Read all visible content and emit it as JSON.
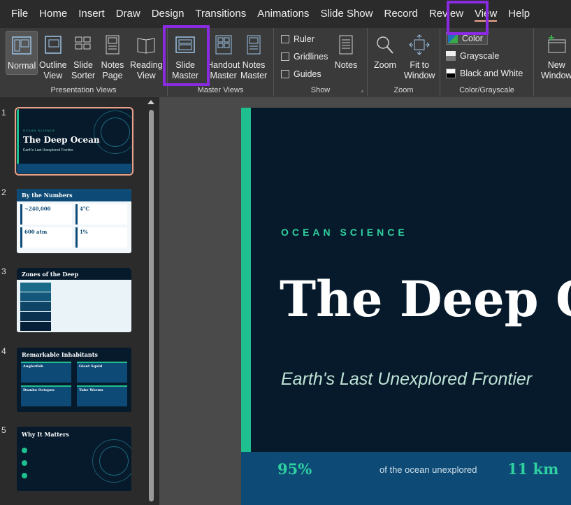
{
  "menu": [
    "File",
    "Home",
    "Insert",
    "Draw",
    "Design",
    "Transitions",
    "Animations",
    "Slide Show",
    "Record",
    "Review",
    "View",
    "Help"
  ],
  "ribbon": {
    "presentation_views": {
      "label": "Presentation Views",
      "normal": "Normal",
      "outline": [
        "Outline",
        "View"
      ],
      "sorter": [
        "Slide",
        "Sorter"
      ],
      "notes_page": [
        "Notes",
        "Page"
      ],
      "reading": [
        "Reading",
        "View"
      ]
    },
    "master_views": {
      "label": "Master Views",
      "slide_master": [
        "Slide",
        "Master"
      ],
      "handout_master": [
        "Handout",
        "Master"
      ],
      "notes_master": [
        "Notes",
        "Master"
      ]
    },
    "show": {
      "label": "Show",
      "ruler": "Ruler",
      "gridlines": "Gridlines",
      "guides": "Guides",
      "notes": "Notes"
    },
    "zoom": {
      "label": "Zoom",
      "zoom": "Zoom",
      "fit": [
        "Fit to",
        "Window"
      ]
    },
    "color": {
      "label": "Color/Grayscale",
      "color": "Color",
      "grayscale": "Grayscale",
      "bw": "Black and White"
    },
    "window": {
      "new": [
        "New",
        "Window"
      ]
    }
  },
  "thumbnails": [
    {
      "num": "1",
      "title": "The Deep Ocean",
      "sub": "Earth's Last Unexplored Frontier",
      "eyebrow": "OCEAN SCIENCE"
    },
    {
      "num": "2",
      "title": "By the Numbers",
      "cards": [
        "~240,000",
        "4°C",
        "600 atm",
        "1%"
      ]
    },
    {
      "num": "3",
      "title": "Zones of the Deep"
    },
    {
      "num": "4",
      "title": "Remarkable Inhabitants",
      "cards": [
        "Anglerfish",
        "Giant Squid",
        "Dumbo Octopus",
        "Tube Worms"
      ]
    },
    {
      "num": "5",
      "title": "Why It Matters"
    }
  ],
  "slide": {
    "eyebrow": "OCEAN SCIENCE",
    "title": "The Deep O",
    "subtitle": "Earth's Last Unexplored Frontier",
    "stat1_value": "95%",
    "stat1_label": "of the ocean unexplored",
    "stat2_value": "11 km"
  },
  "colors": {
    "accent": "#1fbf8f",
    "highlight": "#8a2be2",
    "slide_bg": "#061a2b"
  }
}
